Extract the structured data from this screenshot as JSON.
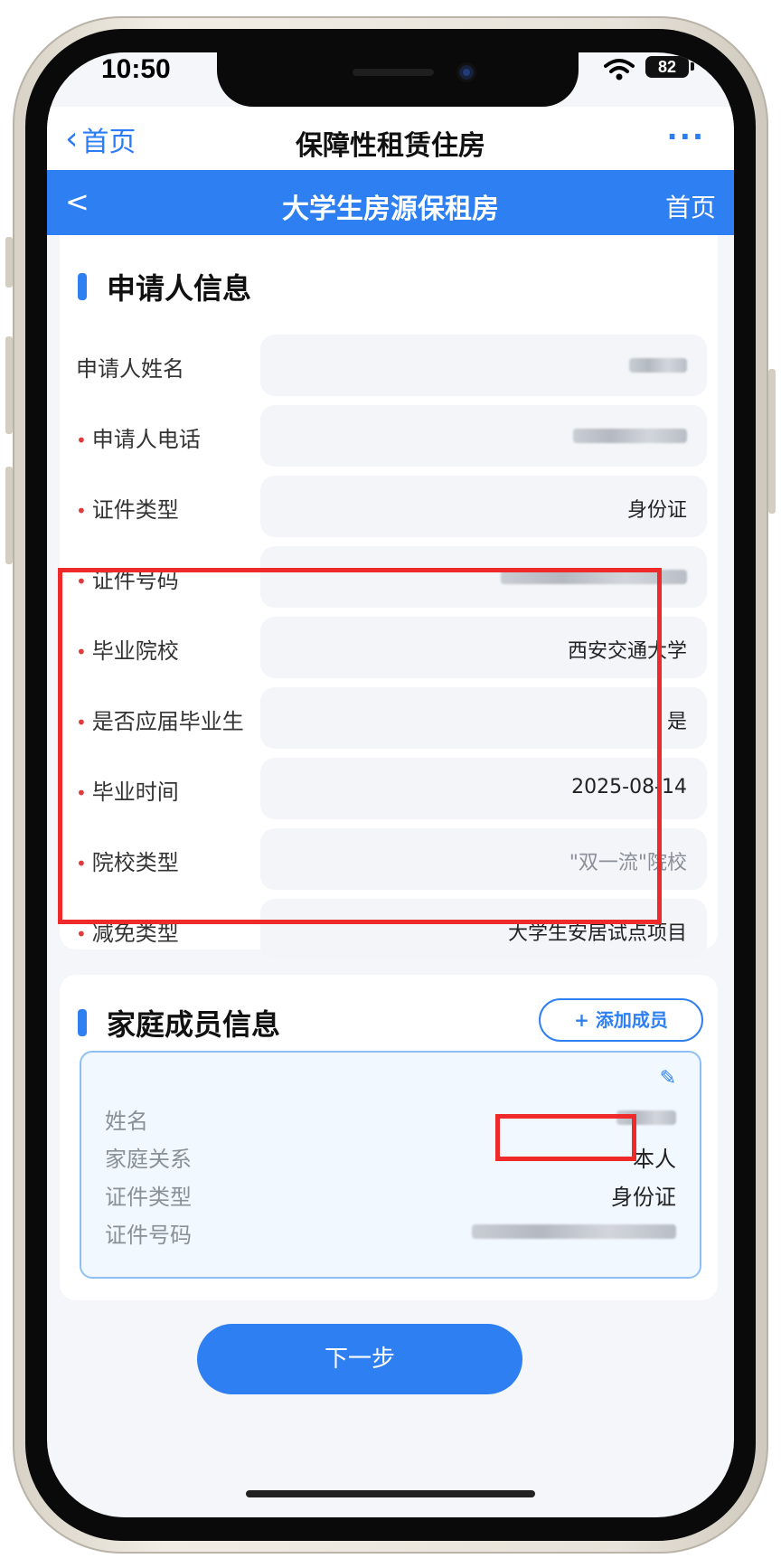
{
  "status_bar": {
    "time": "10:50",
    "battery": "82"
  },
  "mini_program_nav": {
    "back_label": "首页",
    "title": "保障性租赁住房",
    "more": "···"
  },
  "app_header": {
    "back": "<",
    "title": "大学生房源保租房",
    "home": "首页"
  },
  "applicant": {
    "title": "申请人信息",
    "fields": [
      {
        "label": "申请人姓名",
        "required": false,
        "value": "",
        "redacted": true
      },
      {
        "label": "申请人电话",
        "required": true,
        "value": "",
        "redacted": true
      },
      {
        "label": "证件类型",
        "required": true,
        "value": "身份证"
      },
      {
        "label": "证件号码",
        "required": true,
        "value": "",
        "redacted": true
      },
      {
        "label": "毕业院校",
        "required": true,
        "value": "西安交通大学"
      },
      {
        "label": "是否应届毕业生",
        "required": true,
        "value": "是"
      },
      {
        "label": "毕业时间",
        "required": true,
        "value": "2025-08-14"
      },
      {
        "label": "院校类型",
        "required": true,
        "value": "\"双一流\"院校",
        "muted": true
      },
      {
        "label": "减免类型",
        "required": true,
        "value": "大学生安居试点项目"
      }
    ]
  },
  "family": {
    "title": "家庭成员信息",
    "add_button": "+ 添加成员",
    "member": {
      "rows": [
        {
          "label": "姓名",
          "value": "",
          "redacted": true
        },
        {
          "label": "家庭关系",
          "value": "本人"
        },
        {
          "label": "证件类型",
          "value": "身份证"
        },
        {
          "label": "证件号码",
          "value": "",
          "redacted": true
        }
      ]
    }
  },
  "next_button": "下一步",
  "required_mark": "•",
  "colors": {
    "primary": "#2e7ff2",
    "annotation": "#ee2a2a",
    "required": "#e23b3b"
  }
}
